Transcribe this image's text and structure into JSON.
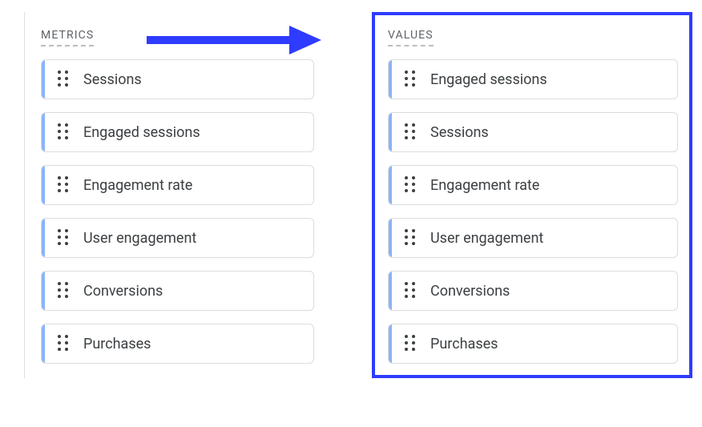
{
  "colors": {
    "accent": "#8ab4f8",
    "arrow": "#2e3cff",
    "highlightBorder": "#2e3cff",
    "label": "#5f6368",
    "text": "#3c4043"
  },
  "left": {
    "heading": "METRICS",
    "items": [
      {
        "label": "Sessions"
      },
      {
        "label": "Engaged sessions"
      },
      {
        "label": "Engagement rate"
      },
      {
        "label": "User engagement"
      },
      {
        "label": "Conversions"
      },
      {
        "label": "Purchases"
      }
    ]
  },
  "right": {
    "heading": "VALUES",
    "items": [
      {
        "label": "Engaged sessions"
      },
      {
        "label": "Sessions"
      },
      {
        "label": "Engagement rate"
      },
      {
        "label": "User engagement"
      },
      {
        "label": "Conversions"
      },
      {
        "label": "Purchases"
      }
    ]
  }
}
